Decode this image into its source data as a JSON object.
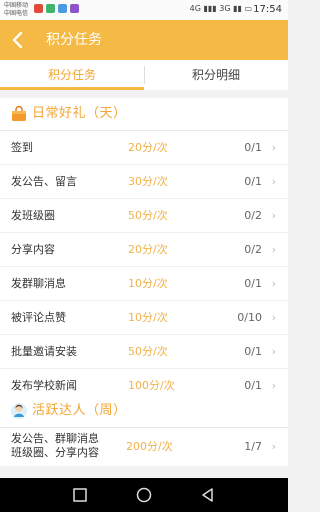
{
  "status": {
    "carrier1": "中国移动",
    "carrier2": "中国电信",
    "network": "4G",
    "signal2": "3G",
    "time": "17:54",
    "app_colors": [
      "#e24a3b",
      "#3db46b",
      "#4b9be0",
      "#8c55cc"
    ]
  },
  "appbar": {
    "title": "积分任务",
    "back_icon": "back-arrow-icon"
  },
  "tabs": [
    {
      "label": "积分任务",
      "active": true
    },
    {
      "label": "积分明细",
      "active": false
    }
  ],
  "section1": {
    "title": "日常好礼（天）",
    "icon": "gift-bag-icon"
  },
  "daily_tasks": [
    {
      "name": "签到",
      "points": "20分/次",
      "count": "0/1"
    },
    {
      "name": "发公告、留言",
      "points": "30分/次",
      "count": "0/1"
    },
    {
      "name": "发班级圈",
      "points": "50分/次",
      "count": "0/2"
    },
    {
      "name": "分享内容",
      "points": "20分/次",
      "count": "0/2"
    },
    {
      "name": "发群聊消息",
      "points": "10分/次",
      "count": "0/1"
    },
    {
      "name": "被评论点赞",
      "points": "10分/次",
      "count": "0/10"
    },
    {
      "name": "批量邀请安装",
      "points": "50分/次",
      "count": "0/1"
    },
    {
      "name": "发布学校新闻",
      "points": "100分/次",
      "count": "0/1"
    }
  ],
  "section2": {
    "title": "活跃达人（周）",
    "icon": "user-avatar-icon"
  },
  "weekly_tasks": [
    {
      "name_line1": "发公告、群聊消息",
      "name_line2": "班级圈、分享内容",
      "points": "200分/次",
      "count": "1/7"
    }
  ],
  "accent_color": "#f5b945"
}
